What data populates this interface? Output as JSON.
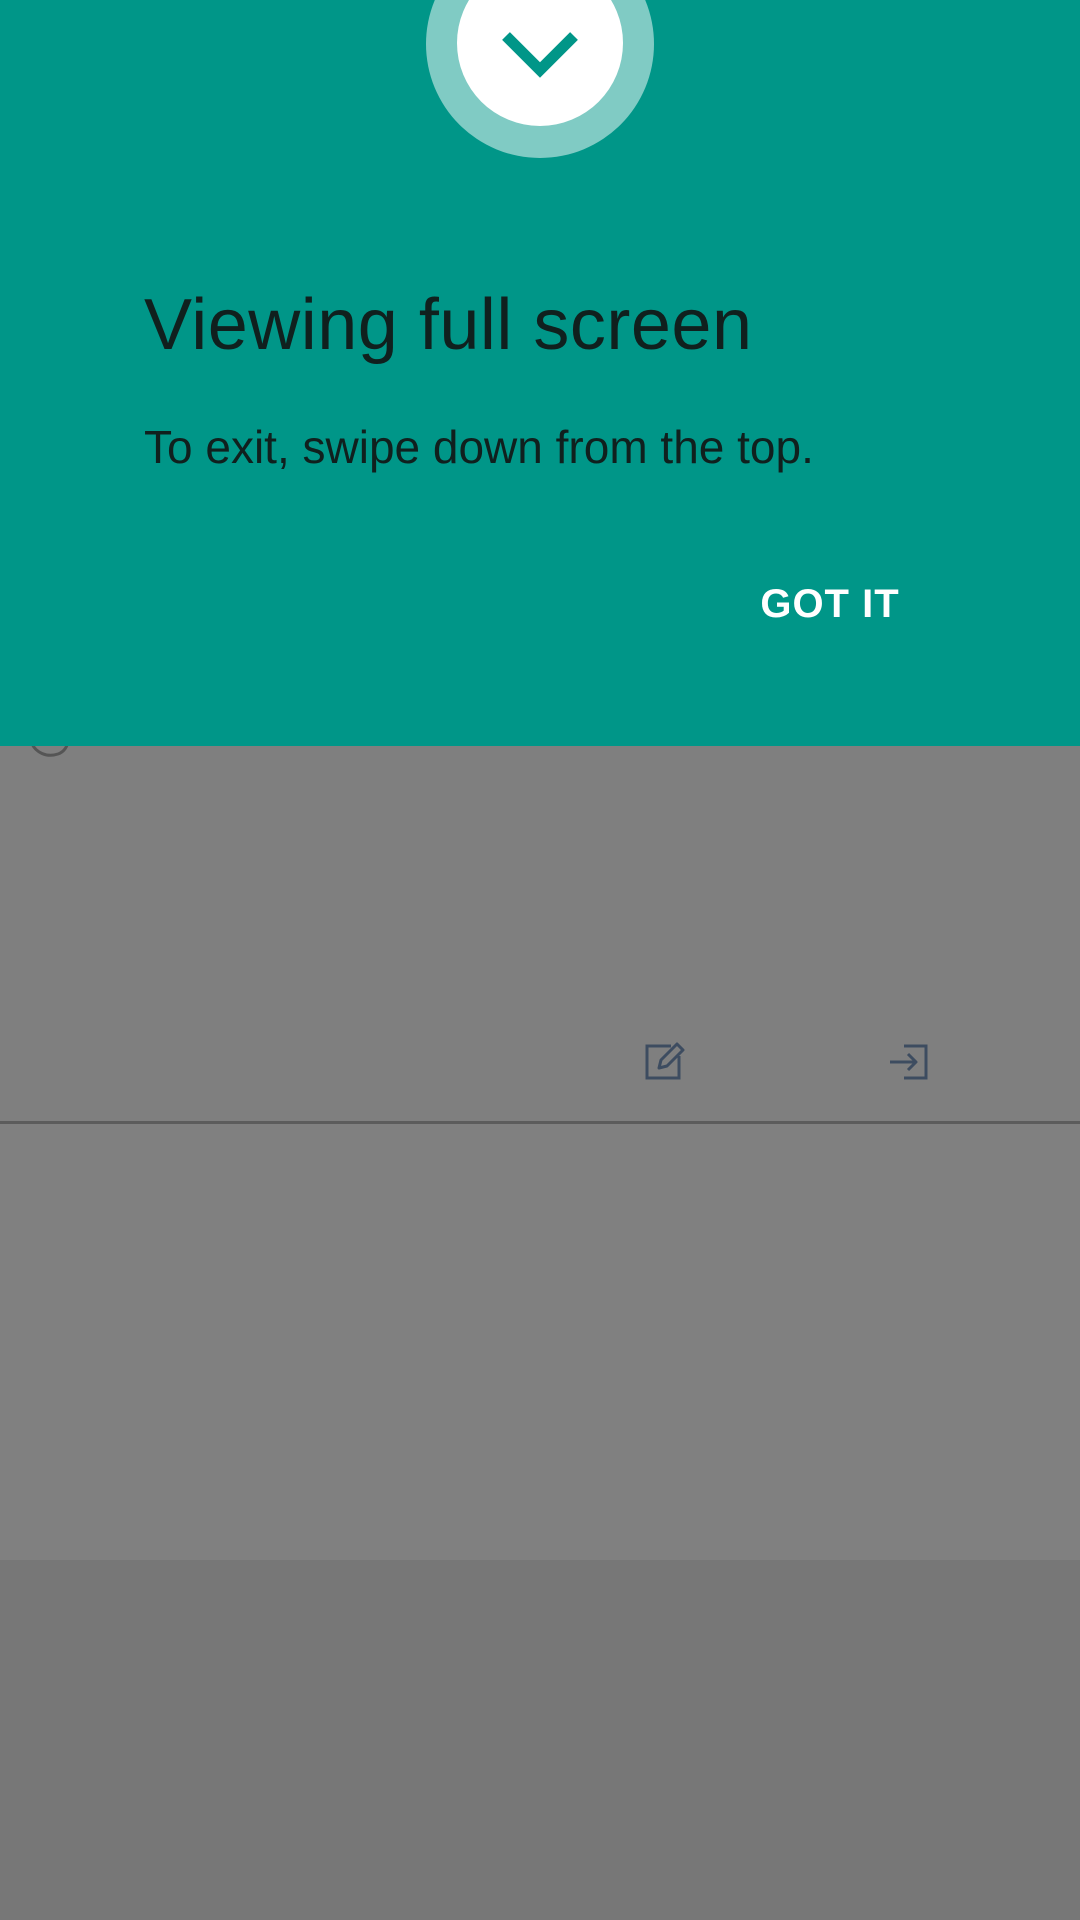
{
  "confirmation": {
    "title": "Viewing full screen",
    "message": "To exit, swipe down from the top.",
    "dismiss_label": "GOT IT",
    "icon": "chevron-down-icon"
  },
  "background_app": {
    "toolbar_icons": [
      "edit-icon",
      "sign-in-icon"
    ],
    "partial_icon": "refresh-icon"
  },
  "colors": {
    "panel": "#009688",
    "badge_ring": "#80cbc4",
    "dim_overlay": "#7f7f7f",
    "title_text": "#10201e",
    "button_text": "#ffffff"
  }
}
